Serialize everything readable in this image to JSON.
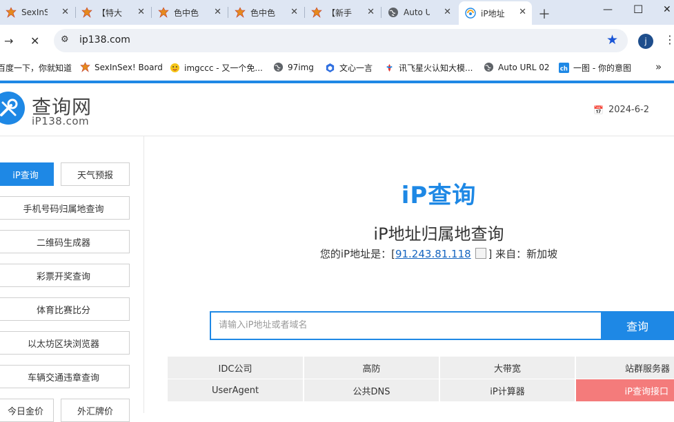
{
  "browser": {
    "tabs": [
      {
        "title": "SexInS"
      },
      {
        "title": "【特大"
      },
      {
        "title": "色中色"
      },
      {
        "title": "色中色"
      },
      {
        "title": "【新手"
      },
      {
        "title": "Auto U"
      },
      {
        "title": "iP地址"
      }
    ],
    "url": "ip138.com",
    "profile_initial": "j",
    "bookmarks": [
      {
        "label": "百度一下，你就知道"
      },
      {
        "label": "SexInSex! Board"
      },
      {
        "label": "imgccc - 又一个免..."
      },
      {
        "label": "97img"
      },
      {
        "label": "文心一言"
      },
      {
        "label": "讯飞星火认知大模..."
      },
      {
        "label": "Auto URL 02"
      },
      {
        "label": "一图 - 你的意图"
      }
    ]
  },
  "header": {
    "logo_cn": "查询网",
    "logo_en": "iP138.com",
    "date": "2024-6-2"
  },
  "sidebar": {
    "items": [
      {
        "label": "iP查询"
      },
      {
        "label": "天气预报"
      },
      {
        "label": "手机号码归属地查询"
      },
      {
        "label": "二维码生成器"
      },
      {
        "label": "彩票开奖查询"
      },
      {
        "label": "体育比赛比分"
      },
      {
        "label": "以太坊区块浏览器"
      },
      {
        "label": "车辆交通违章查询"
      },
      {
        "label": "今日金价"
      },
      {
        "label": "外汇牌价"
      }
    ]
  },
  "main": {
    "title": "iP查询",
    "subtitle": "iP地址归属地查询",
    "ip_prefix": "您的iP地址是：[",
    "ip_address": "91.243.81.118",
    "ip_suffix": "] 来自：新加坡",
    "search_placeholder": "请输入iP地址或者域名",
    "search_button": "查询",
    "links_row1": [
      "IDC公司",
      "高防",
      "大带宽",
      "站群服务器"
    ],
    "links_row2": [
      "UserAgent",
      "公共DNS",
      "iP计算器",
      "iP查询接口"
    ]
  },
  "colors": {
    "accent": "#1e88e5",
    "highlight": "#f47b7b"
  }
}
